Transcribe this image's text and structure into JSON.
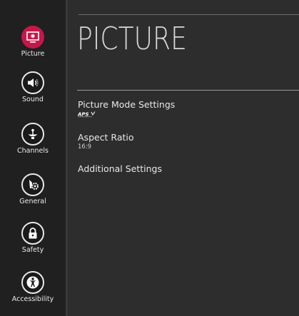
{
  "sidebar": {
    "items": [
      {
        "label": "Picture",
        "icon": "picture-icon",
        "active": true
      },
      {
        "label": "Sound",
        "icon": "speaker-icon",
        "active": false
      },
      {
        "label": "Channels",
        "icon": "satellite-dish-icon",
        "active": false
      },
      {
        "label": "General",
        "icon": "tools-icon",
        "active": false
      },
      {
        "label": "Safety",
        "icon": "lock-icon",
        "active": false
      },
      {
        "label": "Accessibility",
        "icon": "accessibility-icon",
        "active": false
      }
    ]
  },
  "main": {
    "title": "PICTURE",
    "menu": [
      {
        "label": "Picture Mode Settings",
        "value_logo": "aps-logo"
      },
      {
        "label": "Aspect Ratio",
        "value": "16:9"
      },
      {
        "label": "Additional Settings"
      }
    ]
  },
  "colors": {
    "accent": "#c5174a",
    "background": "#2d2d2d",
    "sidebar": "#202020"
  }
}
